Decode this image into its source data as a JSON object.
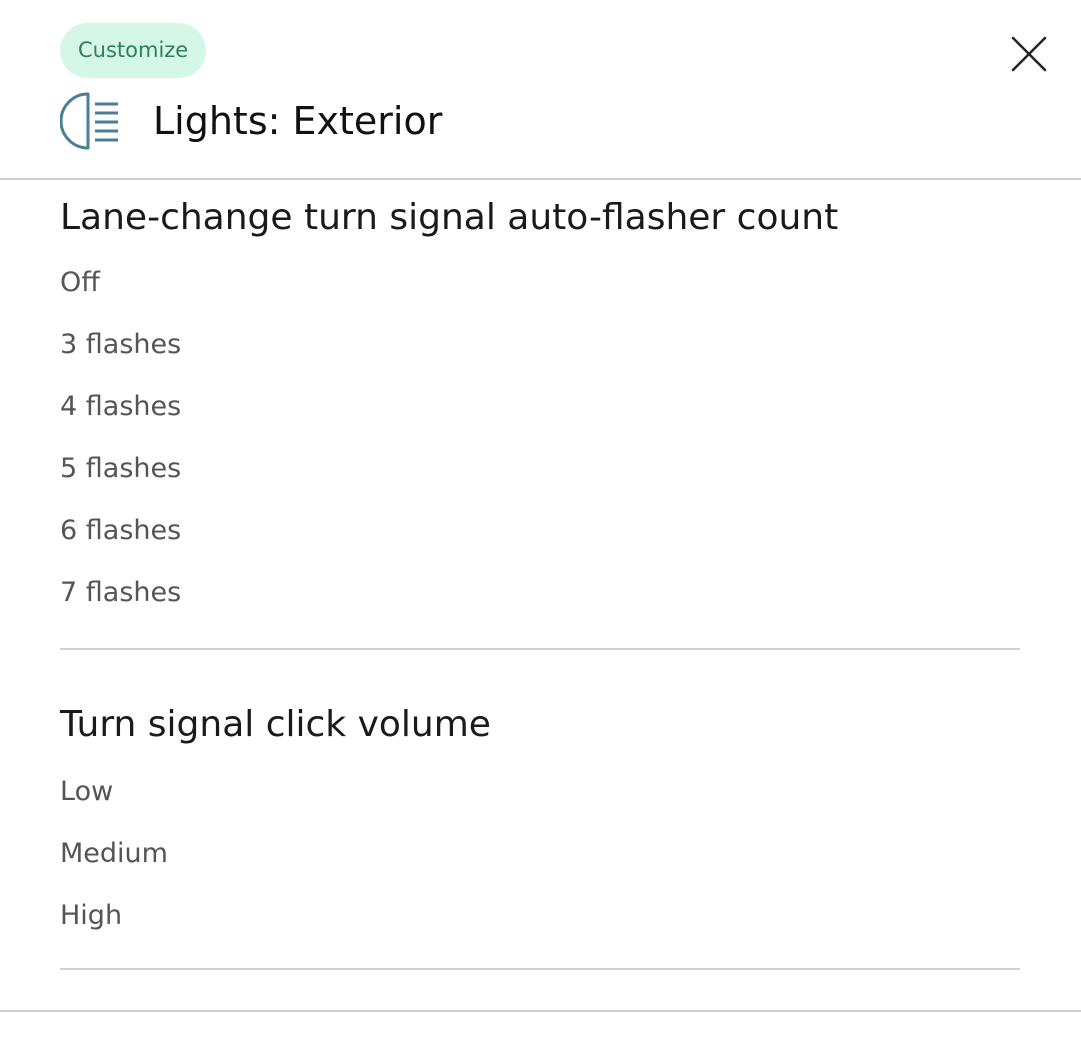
{
  "header": {
    "badge_label": "Customize",
    "title": "Lights: Exterior",
    "icon": "headlight-icon",
    "close_icon": "close-icon"
  },
  "sections": [
    {
      "title": "Lane-change turn signal auto-flasher count",
      "options": [
        "Off",
        "3 flashes",
        "4 flashes",
        "5 flashes",
        "6 flashes",
        "7 flashes"
      ]
    },
    {
      "title": "Turn signal click volume",
      "options": [
        "Low",
        "Medium",
        "High"
      ]
    }
  ],
  "colors": {
    "badge_bg": "#d4f7e8",
    "badge_text": "#2f7f59",
    "icon_stroke": "#4a7f96",
    "divider": "#cfcfcf"
  }
}
